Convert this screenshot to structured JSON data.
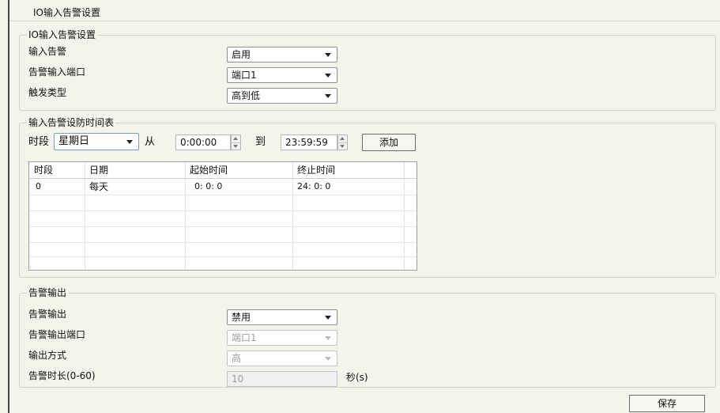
{
  "page": {
    "title": "IO输入告警设置"
  },
  "alarm_input": {
    "legend": "IO输入告警设置",
    "enable_label": "输入告警",
    "enable_value": "启用",
    "port_label": "告警输入端口",
    "port_value": "端口1",
    "trigger_label": "触发类型",
    "trigger_value": "高到低"
  },
  "schedule": {
    "legend": "输入告警设防时间表",
    "period_label": "时段",
    "day_value": "星期日",
    "from_label": "从",
    "start_time": "0:00:00",
    "to_label": "到",
    "end_time": "23:59:59",
    "add_label": "添加",
    "table": {
      "columns": [
        "时段",
        "日期",
        "起始时间",
        "终止时间"
      ],
      "rows": [
        [
          "0",
          "每天",
          "0: 0: 0",
          "24: 0: 0"
        ]
      ]
    }
  },
  "alarm_output": {
    "legend": "告警输出",
    "enable_label": "告警输出",
    "enable_value": "禁用",
    "port_label": "告警输出端口",
    "port_value": "端口1",
    "mode_label": "输出方式",
    "mode_value": "高",
    "duration_label": "告警时长(0-60)",
    "duration_value": "10",
    "duration_unit": "秒(s)"
  },
  "footer": {
    "save_label": "保存"
  }
}
